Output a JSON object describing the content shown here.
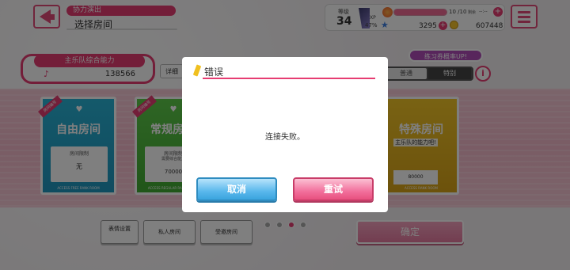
{
  "header": {
    "title_tag": "协力演出",
    "title": "选择房间"
  },
  "status": {
    "level_label": "等级",
    "level": "34",
    "xp_label": "XP",
    "xp_pct": "47%",
    "stamina": "10 /10",
    "stamina_fraction": 1.0,
    "recover_label": "剩余",
    "recover_time": "--:--",
    "gems": "3295",
    "coins": "607448"
  },
  "power": {
    "label": "主乐队综合能力",
    "value": "138566",
    "detail_button": "详细"
  },
  "practice_tag": "练习券概率UP!",
  "mode": {
    "normal": "普通",
    "special": "特别"
  },
  "cards": {
    "free": {
      "ribbon": "房间编号",
      "title": "自由房间",
      "limit_label": "房间限制",
      "limit_value": "无",
      "footer": "ACCESS FREE RANK ROOM"
    },
    "regular": {
      "ribbon": "房间编号",
      "title": "常规房间",
      "limit_label": "房间限制",
      "limit_sub": "需要综合能力",
      "limit_value": "70000",
      "footer": "ACCESS REGULAR RANK ROOM"
    },
    "special": {
      "title": "特殊房间",
      "desc": "主乐队的能力吧!",
      "value": "80000",
      "footer": "ACCESS RANK ROOM"
    }
  },
  "bottom": {
    "emote": "表情设置",
    "private": "私人房间",
    "invite": "受邀房间",
    "confirm": "确定"
  },
  "dialog": {
    "title": "错误",
    "message": "连接失败。",
    "cancel": "取消",
    "retry": "重试"
  }
}
